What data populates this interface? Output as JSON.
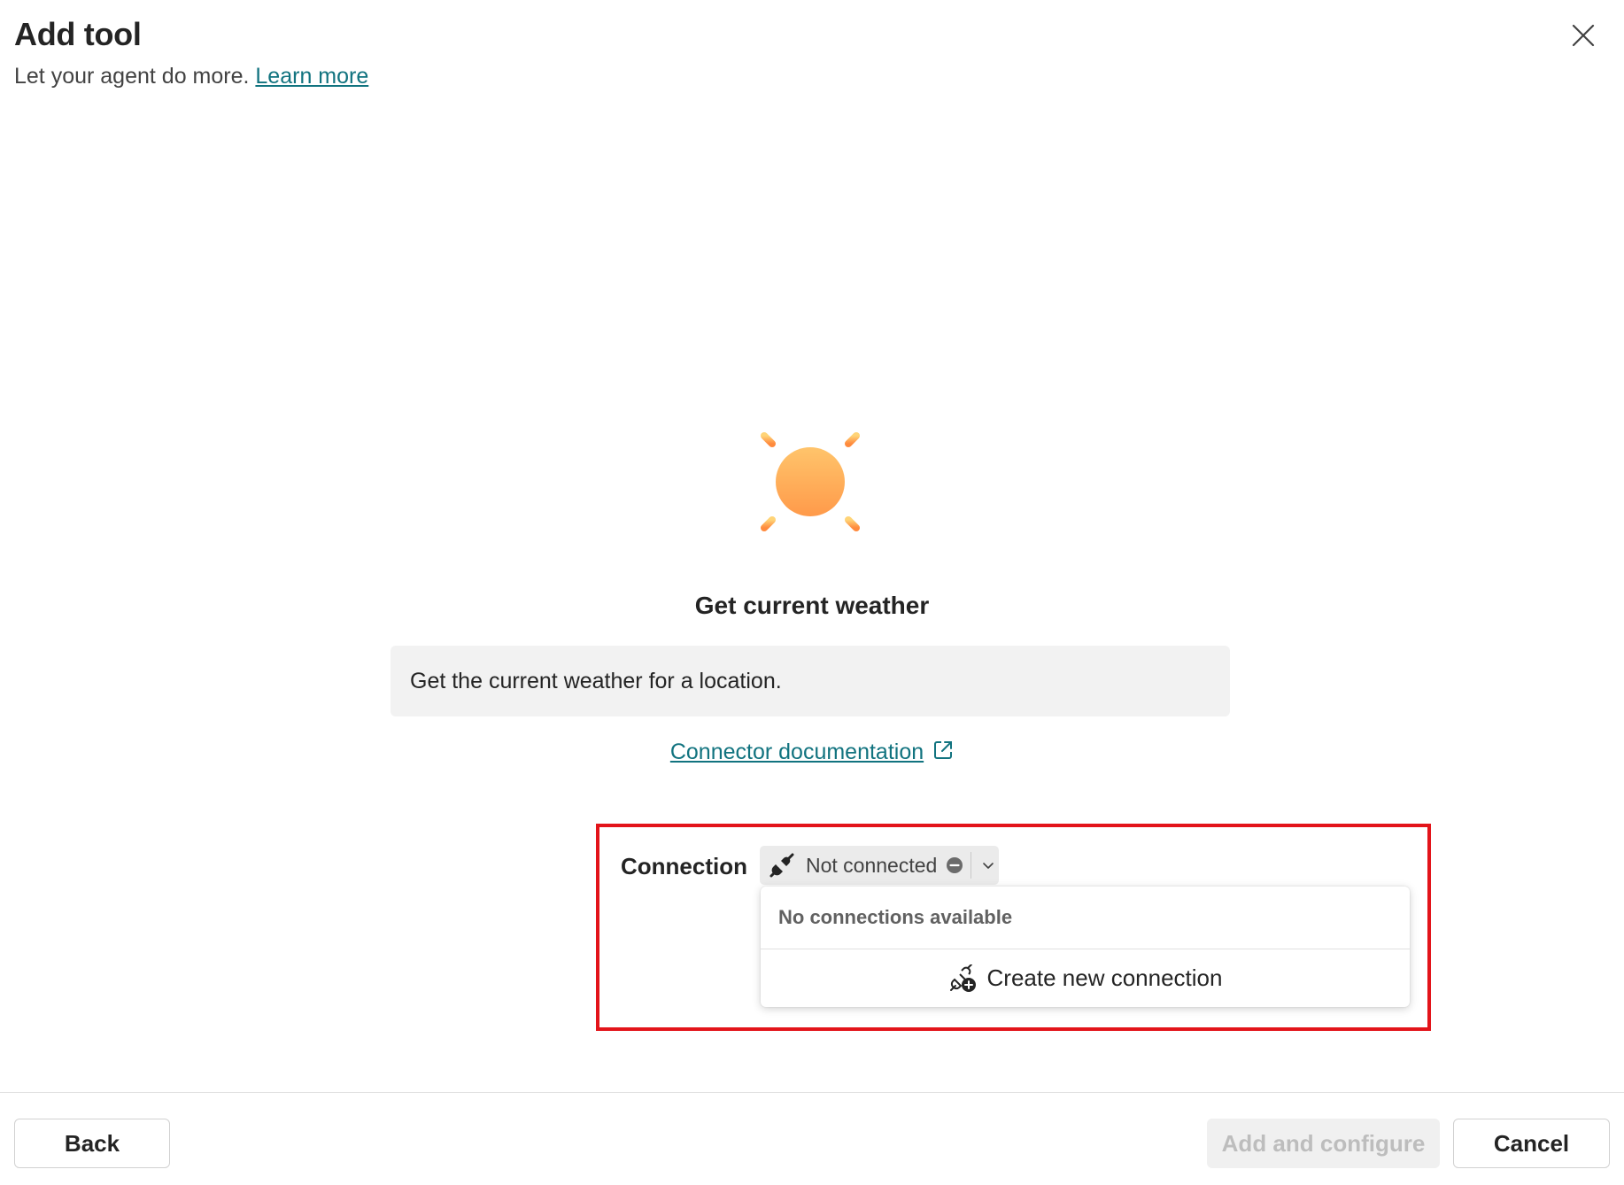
{
  "dialog": {
    "title": "Add tool",
    "subtitle": "Let your agent do more.",
    "learn_more": "Learn more"
  },
  "tool": {
    "icon": "sun-icon",
    "name": "Get current weather",
    "description": "Get the current weather for a location.",
    "doc_link": "Connector documentation"
  },
  "connection": {
    "label": "Connection",
    "status": "Not connected",
    "menu": {
      "empty_text": "No connections available",
      "create_label": "Create new connection"
    }
  },
  "footer": {
    "back": "Back",
    "add_configure": "Add and configure",
    "cancel": "Cancel"
  },
  "colors": {
    "link": "#11737f",
    "highlight": "#e3141a",
    "sun_top": "#ffc46b",
    "sun_bottom": "#ff9a4a"
  }
}
